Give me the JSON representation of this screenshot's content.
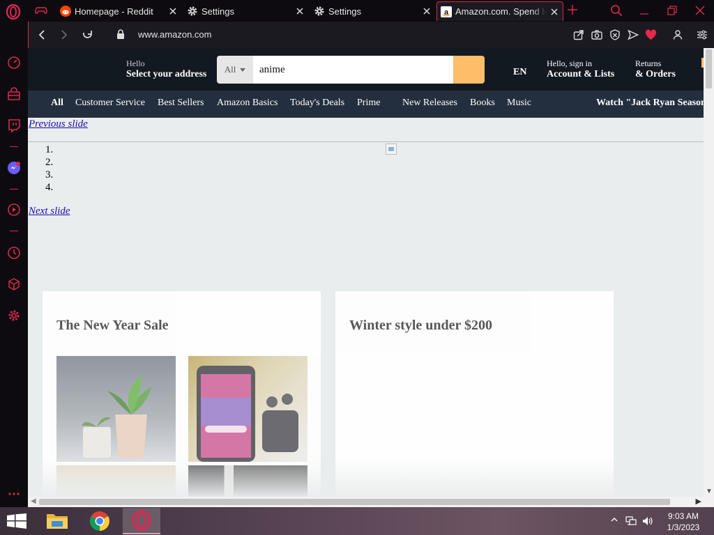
{
  "browser": {
    "tabs": [
      {
        "title": "Homepage - Reddit",
        "favicon": "reddit-icon"
      },
      {
        "title": "Settings",
        "favicon": "gear-icon"
      },
      {
        "title": "Settings",
        "favicon": "gear-icon"
      },
      {
        "title": "Amazon.com. Spend less. Smile more.",
        "favicon": "amazon-icon",
        "active": true
      }
    ],
    "url": "www.amazon.com",
    "accent_color": "#d52b4f"
  },
  "sidebar": {
    "items": [
      "speed-dial-icon",
      "shopping-bag-icon",
      "twitch-icon",
      "messenger-icon",
      "player-icon",
      "history-icon",
      "cube-icon",
      "settings-icon",
      "more-icon"
    ]
  },
  "amazon": {
    "deliver": {
      "hello": "Hello",
      "address": "Select your address"
    },
    "search": {
      "category": "All",
      "query": "anime"
    },
    "language": "EN",
    "account": {
      "line1": "Hello, sign in",
      "line2": "Account & Lists"
    },
    "returns": {
      "line1": "Returns",
      "line2": "& Orders"
    },
    "nav": [
      "All",
      "Customer Service",
      "Best Sellers",
      "Amazon Basics",
      "Today's Deals",
      "Prime",
      "New Releases",
      "Books",
      "Music",
      "Watch \"Jack Ryan Season"
    ],
    "carousel": {
      "prev": "Previous slide",
      "next": "Next slide",
      "items": [
        "1.",
        "2.",
        "3.",
        "4."
      ]
    },
    "cards": [
      {
        "title": "The New Year Sale"
      },
      {
        "title": "Winter style under $200"
      }
    ]
  },
  "taskbar": {
    "apps": [
      "file-explorer-icon",
      "chrome-icon",
      "opera-icon"
    ],
    "time": "9:03 AM",
    "date": "1/3/2023"
  }
}
